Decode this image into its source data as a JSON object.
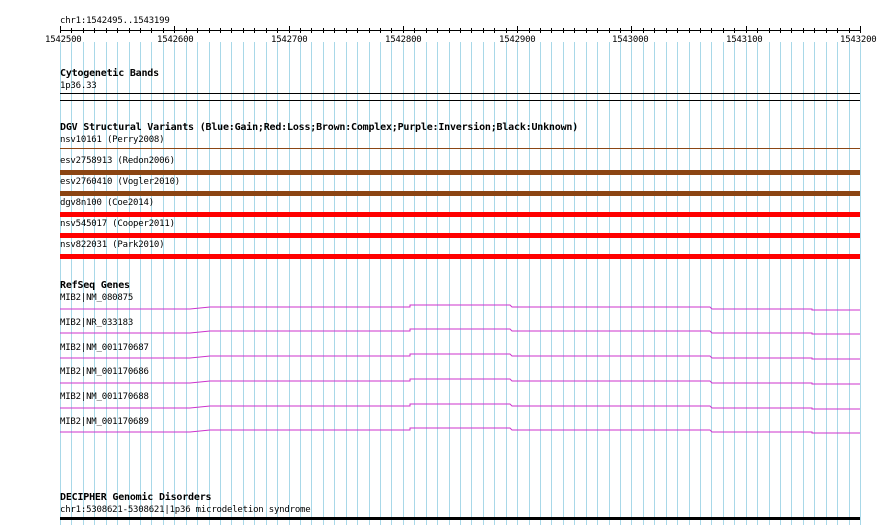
{
  "location": "chr1:1542495..1543199",
  "ruler": {
    "labels": [
      "1542500",
      "1542600",
      "1542700",
      "1542800",
      "1542900",
      "1543000",
      "1543100",
      "1543200"
    ]
  },
  "tracks": {
    "cytoband": {
      "title": "Cytogenetic Bands",
      "band_label": "1p36.33"
    },
    "dgv": {
      "title": "DGV Structural Variants (Blue:Gain;Red:Loss;Brown:Complex;Purple:Inversion;Black:Unknown)",
      "items": [
        {
          "label": "nsv10161 (Perry2008)",
          "color": "#8b4513"
        },
        {
          "label": "esv2758913 (Redon2006)",
          "color": "#8b4513"
        },
        {
          "label": "esv2760410 (Vogler2010)",
          "color": "#8b4513"
        },
        {
          "label": "dgv8n100 (Coe2014)",
          "color": "#ff0000"
        },
        {
          "label": "nsv545017 (Cooper2011)",
          "color": "#ff0000"
        },
        {
          "label": "nsv822031 (Park2010)",
          "color": "#ff0000"
        }
      ]
    },
    "refseq": {
      "title": "RefSeq Genes",
      "color": "#cc33cc",
      "genes": [
        {
          "label": "MIB2|NM_080875"
        },
        {
          "label": "MIB2|NR_033183"
        },
        {
          "label": "MIB2|NM_001170687"
        },
        {
          "label": "MIB2|NM_001170686"
        },
        {
          "label": "MIB2|NM_001170688"
        },
        {
          "label": "MIB2|NM_001170689"
        }
      ]
    },
    "decipher": {
      "title": "DECIPHER Genomic Disorders",
      "items": [
        {
          "label": "chr1:5308621-5308621|1p36 microdeletion syndrome",
          "color": "#000000"
        }
      ]
    }
  },
  "colors": {
    "grid": "#a8d8e8",
    "axis": "#000000"
  }
}
